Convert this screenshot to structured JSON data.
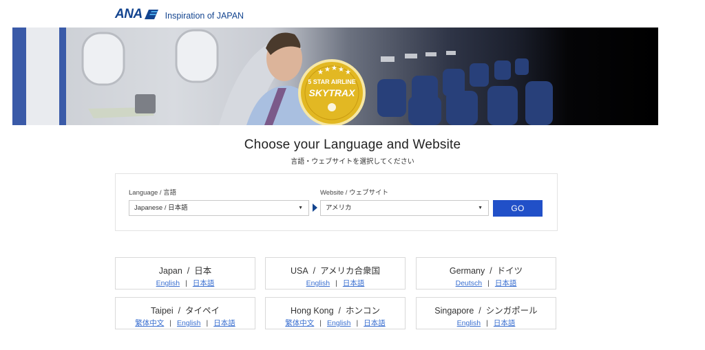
{
  "brand": {
    "logo": "ANA",
    "tagline": "Inspiration of JAPAN"
  },
  "hero": {
    "badge_line1": "5 STAR AIRLINE",
    "badge_line2": "SKYTRAX",
    "badge_stars": 5
  },
  "heading": {
    "title": "Choose your Language and Website",
    "subtitle": "言語・ウェブサイトを選択してください"
  },
  "selector": {
    "language_label": "Language / 言語",
    "language_value": "Japanese / 日本語",
    "website_label": "Website / ウェブサイト",
    "website_value": "アメリカ",
    "go_label": "GO"
  },
  "regions": [
    {
      "name": "Japan",
      "native": "日本",
      "links": [
        "English",
        "日本語"
      ]
    },
    {
      "name": "USA",
      "native": "アメリカ合衆国",
      "links": [
        "English",
        "日本語"
      ]
    },
    {
      "name": "Germany",
      "native": "ドイツ",
      "links": [
        "Deutsch",
        "日本語"
      ]
    },
    {
      "name": "Taipei",
      "native": "タイペイ",
      "links": [
        "繁体中文",
        "English",
        "日本語"
      ]
    },
    {
      "name": "Hong Kong",
      "native": "ホンコン",
      "links": [
        "繁体中文",
        "English",
        "日本語"
      ]
    },
    {
      "name": "Singapore",
      "native": "シンガポール",
      "links": [
        "English",
        "日本語"
      ]
    }
  ],
  "colors": {
    "brand_blue": "#13448f",
    "go_button": "#2150c8",
    "link": "#3a6fd0",
    "badge_gold": "#e2b823"
  }
}
